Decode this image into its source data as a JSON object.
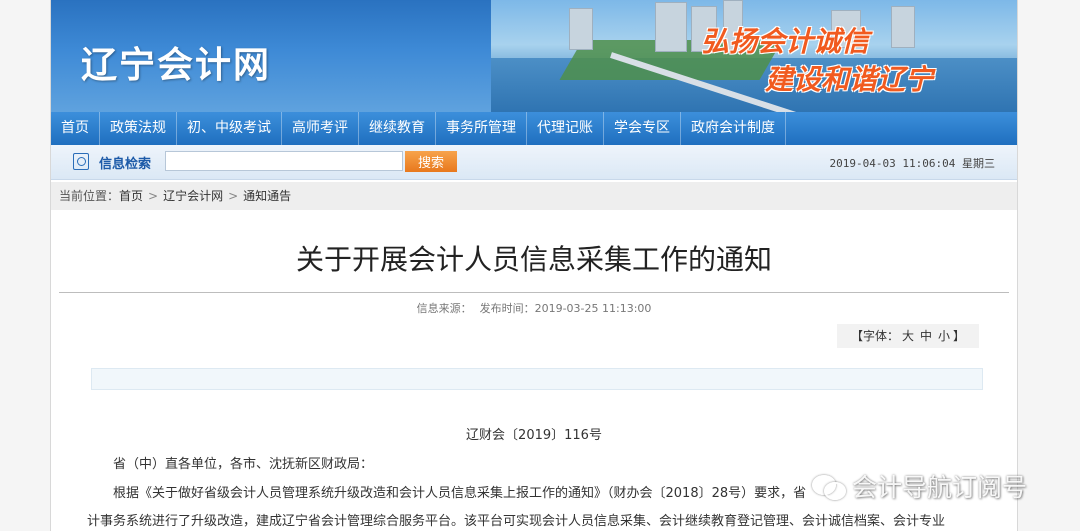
{
  "site": {
    "logo": "辽宁会计网",
    "slogan_line1": "弘扬会计诚信",
    "slogan_line2": "建设和谐辽宁"
  },
  "nav": {
    "items": [
      "首页",
      "政策法规",
      "初、中级考试",
      "高师考评",
      "继续教育",
      "事务所管理",
      "代理记账",
      "学会专区",
      "政府会计制度"
    ]
  },
  "search": {
    "label": "信息检索",
    "placeholder": "",
    "button": "搜索",
    "datetime": "2019-04-03 11:06:04 星期三"
  },
  "breadcrumb": {
    "prefix": "当前位置：",
    "items": [
      "首页",
      "辽宁会计网",
      "通知通告"
    ]
  },
  "article": {
    "title": "关于开展会计人员信息采集工作的通知",
    "source_label": "信息来源：",
    "publish_label": "发布时间：",
    "publish_time": "2019-03-25 11:13:00",
    "fontsize": {
      "open": "【字体：",
      "large": "大",
      "medium": "中",
      "small": "小",
      "close": "】"
    },
    "doc_number": "辽财会〔2019〕116号",
    "para1": "省（中）直各单位，各市、沈抚新区财政局：",
    "para2": "根据《关于做好省级会计人员管理系统升级改造和会计人员信息采集上报工作的通知》（财办会〔2018〕28号）要求，省",
    "para3": "计事务系统进行了升级改造，建成辽宁省会计管理综合服务平台。该平台可实现会计人员信息采集、会计继续教育登记管理、会计诚信档案、会计专业"
  },
  "watermark": {
    "text": "会计导航订阅号"
  }
}
